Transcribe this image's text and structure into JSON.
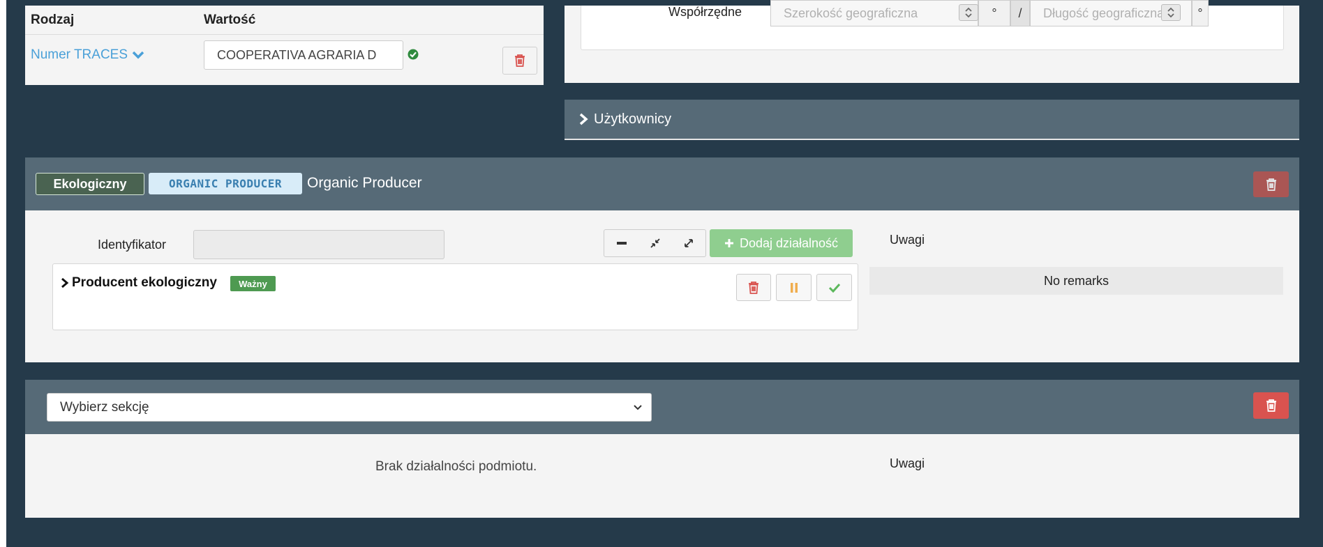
{
  "identifiers_table": {
    "col_type": "Rodzaj",
    "col_value": "Wartość",
    "row": {
      "type_label": "Numer TRACES",
      "value": "COOPERATIVA AGRARIA D"
    }
  },
  "location": {
    "coordinates_label": "Współrzędne",
    "latitude_placeholder": "Szerokość geograficzna",
    "longitude_placeholder": "Długość geograficzna",
    "degree_symbol": "°",
    "separator": "/"
  },
  "users_section": {
    "title": "Użytkownicy"
  },
  "eco_section": {
    "badge_primary": "Ekologiczny",
    "badge_code": "ORGANIC PRODUCER",
    "title": "Organic Producer",
    "identifier_label": "Identyfikator",
    "identifier_value": "",
    "add_activity_label": "Dodaj działalność",
    "remarks_label": "Uwagi",
    "remarks_value": "No remarks",
    "activity": {
      "name": "Producent ekologiczny",
      "status": "Ważny"
    }
  },
  "section_select": {
    "placeholder": "Wybierz sekcję",
    "empty_text": "Brak działalności podmiotu.",
    "remarks_label": "Uwagi"
  },
  "colors": {
    "background": "#253a4a",
    "panel_header": "#566a77",
    "panel_body": "#f4f4f4",
    "danger": "#d9534f",
    "success": "#4e9a51",
    "link": "#4aa0d8"
  }
}
